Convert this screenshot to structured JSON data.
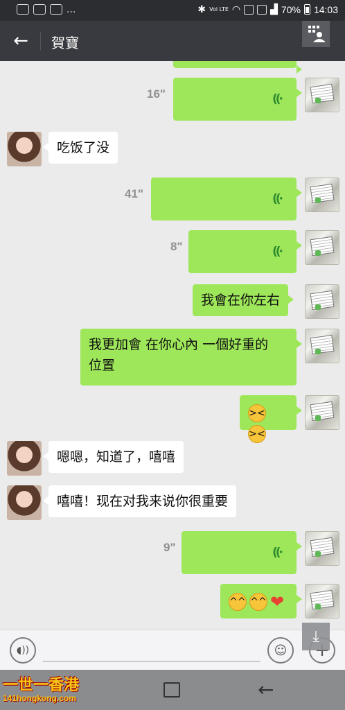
{
  "status_bar": {
    "more": "...",
    "net_label": "Vol LTE",
    "battery": "70%",
    "time": "14:03"
  },
  "header": {
    "title": "賀寶"
  },
  "messages": [
    {
      "from": "me",
      "type": "voice",
      "duration": "16\""
    },
    {
      "from": "her",
      "type": "text",
      "text": "吃饭了没"
    },
    {
      "from": "me",
      "type": "voice",
      "duration": "41\""
    },
    {
      "from": "me",
      "type": "voice",
      "duration": "8\""
    },
    {
      "from": "me",
      "type": "text",
      "text": "我會在你左右"
    },
    {
      "from": "me",
      "type": "text",
      "lines": [
        "我更加會 在你心內 一個好重的",
        "位置"
      ]
    },
    {
      "from": "me",
      "type": "emoji",
      "emojis": [
        "grin-squint",
        "grin-squint"
      ]
    },
    {
      "from": "her",
      "type": "text",
      "text": "嗯嗯，知道了，嘻嘻"
    },
    {
      "from": "her",
      "type": "text",
      "text": "嘻嘻！现在对我来说你很重要"
    },
    {
      "from": "me",
      "type": "voice",
      "duration": "9\""
    },
    {
      "from": "me",
      "type": "emoji",
      "emojis": [
        "smile-chick",
        "smile-chick",
        "heart"
      ]
    }
  ],
  "watermark": {
    "title": "一世一香港",
    "url": "141hongkong.com"
  },
  "colors": {
    "header_bg": "#393a3f",
    "my_bubble": "#9ee75a",
    "her_bubble": "#ffffff",
    "chat_bg": "#ebebeb"
  }
}
